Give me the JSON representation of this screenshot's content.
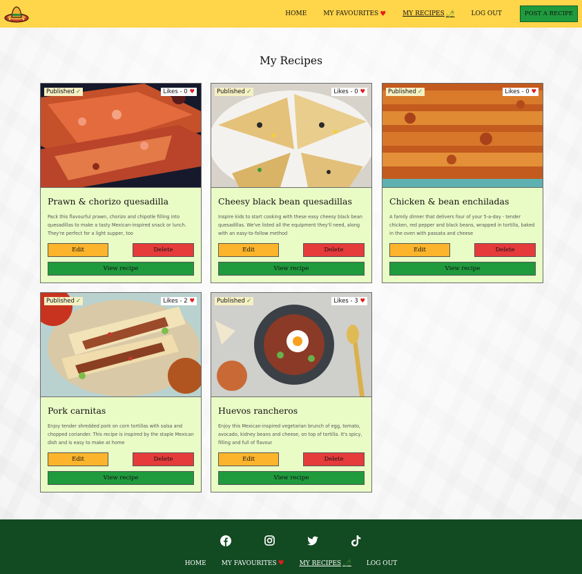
{
  "brand": {
    "logo_icon": "sombrero-icon",
    "colors": {
      "nav": "#ffd54a",
      "card": "#eafcc6",
      "edit": "#fbb42b",
      "delete": "#e53b3b",
      "view": "#1f9a3d",
      "footer": "#124a22"
    }
  },
  "nav": {
    "links": [
      {
        "label": "HOME",
        "icon": ""
      },
      {
        "label": "MY FAVOURITES",
        "icon": "heart-icon"
      },
      {
        "label": "MY RECIPES",
        "icon": "chili-icon",
        "active": true
      },
      {
        "label": "LOG OUT",
        "icon": ""
      }
    ],
    "post_button": "POST A RECIPE"
  },
  "page": {
    "title": "My Recipes"
  },
  "cards": [
    {
      "status": "Published",
      "likes_label": "Likes - 0",
      "title": "Prawn & chorizo quesadilla",
      "description": "Pack this flavourful prawn, chorizo and chipotle filling into quesadillas to make a tasty Mexican-inspired snack or lunch. They're perfect for a light supper, too",
      "edit": "Edit",
      "delete": "Delete",
      "view": "View recipe"
    },
    {
      "status": "Published",
      "likes_label": "Likes - 0",
      "title": "Cheesy black bean quesadillas",
      "description": "Inspire kids to start cooking with these easy cheesy black bean quesadillas. We've listed all the equipment they'll need, along with an easy-to-follow method",
      "edit": "Edit",
      "delete": "Delete",
      "view": "View recipe"
    },
    {
      "status": "Published",
      "likes_label": "Likes - 0",
      "title": "Chicken & bean enchiladas",
      "description": "A family dinner that delivers four of your 5-a-day - tender chicken, red pepper and black beans, wrapped in tortilla, baked in the oven with passata and cheese",
      "edit": "Edit",
      "delete": "Delete",
      "view": "View recipe"
    },
    {
      "status": "Published",
      "likes_label": "Likes - 2",
      "title": "Pork carnitas",
      "description": "Enjoy tender shredded pork on corn tortillas with salsa and chopped coriander. This recipe is inspired by the staple Mexican dish and is easy to make at home",
      "edit": "Edit",
      "delete": "Delete",
      "view": "View recipe"
    },
    {
      "status": "Published",
      "likes_label": "Likes - 3",
      "title": "Huevos rancheros",
      "description": "Enjoy this Mexican-inspired vegetarian brunch of egg, tomato, avocado, kidney beans and cheese, on top of tortilla. It's spicy, filling and full of flavour",
      "edit": "Edit",
      "delete": "Delete",
      "view": "View recipe"
    }
  ],
  "footer": {
    "social_icons": [
      "facebook-icon",
      "instagram-icon",
      "twitter-icon",
      "tiktok-icon"
    ],
    "links": [
      {
        "label": "HOME",
        "icon": ""
      },
      {
        "label": "MY FAVOURITES",
        "icon": "heart-icon"
      },
      {
        "label": "MY RECIPES",
        "icon": "chili-icon",
        "active": true
      },
      {
        "label": "LOG OUT",
        "icon": ""
      }
    ]
  }
}
